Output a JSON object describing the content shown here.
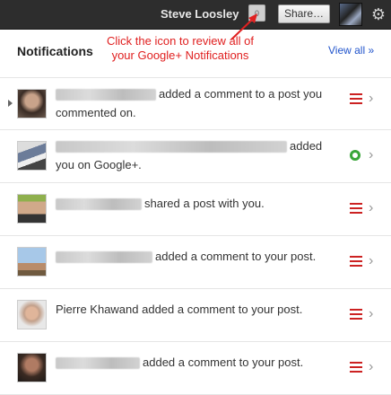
{
  "topbar": {
    "user_name": "Steve Loosley",
    "notification_count": "0",
    "share_label": "Share…",
    "gear_icon": "gear-icon"
  },
  "header": {
    "title": "Notifications",
    "view_all_label": "View all »"
  },
  "annotation": {
    "text": "Click the icon to review all of your Google+ Notifications",
    "color": "#e02020"
  },
  "notifications": [
    {
      "text": "added a comment to a post you commented on.",
      "action_icon": "list-icon",
      "selected": true
    },
    {
      "text": "added you on Google+.",
      "action_icon": "circle-add-icon"
    },
    {
      "text": "shared a post with you.",
      "action_icon": "list-icon"
    },
    {
      "text": "added a comment to your post.",
      "action_icon": "list-icon"
    },
    {
      "text": "Pierre Khawand added a comment to your post.",
      "action_icon": "list-icon"
    },
    {
      "text": "added a comment to your post.",
      "action_icon": "list-icon"
    }
  ],
  "colors": {
    "topbar_bg": "#2d2d2d",
    "link": "#2255cc",
    "list_icon": "#cc2222",
    "add_icon": "#3aa63a"
  }
}
